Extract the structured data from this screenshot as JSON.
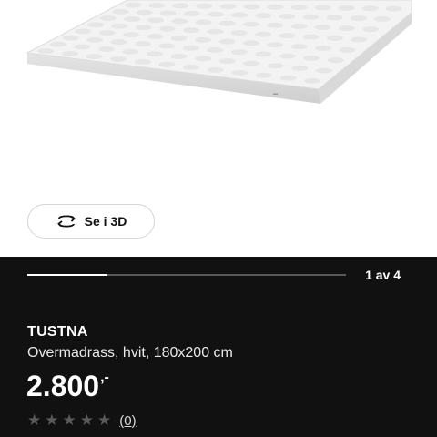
{
  "product_image": {
    "alt_icon": "mattress-topper-image"
  },
  "view3d": {
    "label": "Se i 3D",
    "icon": "rotate-3d-icon"
  },
  "gallery": {
    "pager_text": "1 av 4",
    "progress": 0.25
  },
  "product": {
    "name": "TUSTNA",
    "description": "Overmadrass, hvit, 180x200 cm",
    "price_main": "2.800",
    "price_suffix": ",-",
    "rating": {
      "stars_filled": 0,
      "stars_total": 5,
      "review_count_text": "(0)"
    }
  },
  "colors": {
    "panel_bg": "#111111",
    "star_empty": "#5a5a5a"
  }
}
